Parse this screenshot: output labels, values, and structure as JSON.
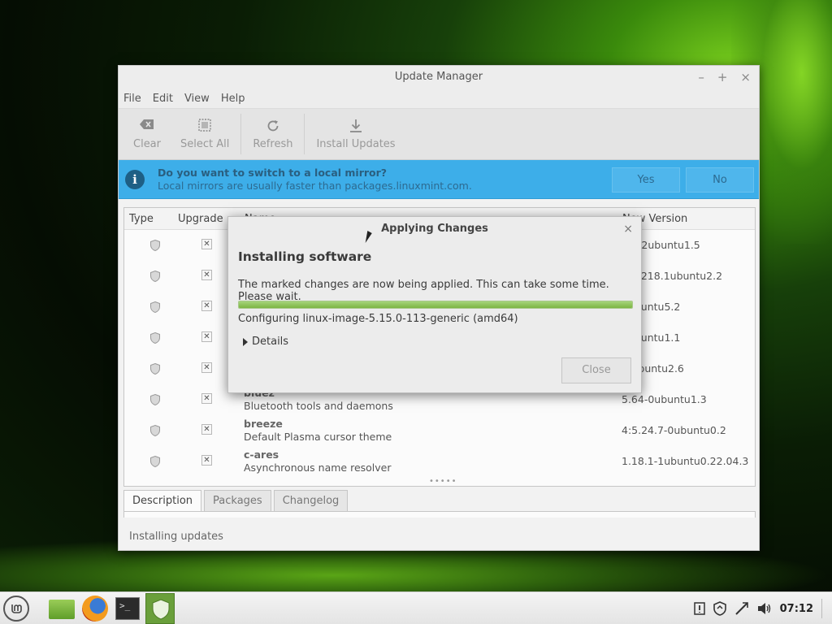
{
  "window": {
    "title": "Update Manager",
    "controls": {
      "minimize": "–",
      "maximize": "+",
      "close": "×"
    }
  },
  "menu": [
    "File",
    "Edit",
    "View",
    "Help"
  ],
  "toolbar": {
    "clear": "Clear",
    "select_all": "Select All",
    "refresh": "Refresh",
    "install": "Install Updates"
  },
  "infobar": {
    "title": "Do you want to switch to a local mirror?",
    "subtitle": "Local mirrors are usually faster than packages.linuxmint.com.",
    "yes": "Yes",
    "no": "No"
  },
  "list": {
    "headers": {
      "type": "Type",
      "upgrade": "Upgrade",
      "name": "Name",
      "version": "New Version"
    },
    "rows": [
      {
        "name": "",
        "desc": "",
        "version": "7.5-2ubuntu1.5"
      },
      {
        "name": "",
        "desc": "",
        "version": "191218.1ubuntu2.2"
      },
      {
        "name": "",
        "desc": "",
        "version": "5ubuntu5.2"
      },
      {
        "name": "",
        "desc": "",
        "version": "5ubuntu1.1"
      },
      {
        "name": "",
        "desc": "",
        "version": "-4ubuntu2.6"
      },
      {
        "name": "bluez",
        "desc": "Bluetooth tools and daemons",
        "version": "5.64-0ubuntu1.3"
      },
      {
        "name": "breeze",
        "desc": "Default Plasma cursor theme",
        "version": "4:5.24.7-0ubuntu0.2"
      },
      {
        "name": "c-ares",
        "desc": "Asynchronous name resolver",
        "version": "1.18.1-1ubuntu0.22.04.3"
      }
    ]
  },
  "tabs": [
    "Description",
    "Packages",
    "Changelog"
  ],
  "status": "Installing updates",
  "dialog": {
    "title": "Applying Changes",
    "close_x": "×",
    "heading": "Installing software",
    "message": "The marked changes are now being applied. This can take some time. Please wait.",
    "progress": 1.0,
    "status": "Configuring linux-image-5.15.0-113-generic (amd64)",
    "details": "Details",
    "close_button": "Close"
  },
  "taskbar": {
    "terminal_glyph": ">_",
    "clock": "07:12"
  },
  "colors": {
    "accent": "#3daee9",
    "progress": "#7cb543",
    "task_active": "#6a9f3b"
  }
}
